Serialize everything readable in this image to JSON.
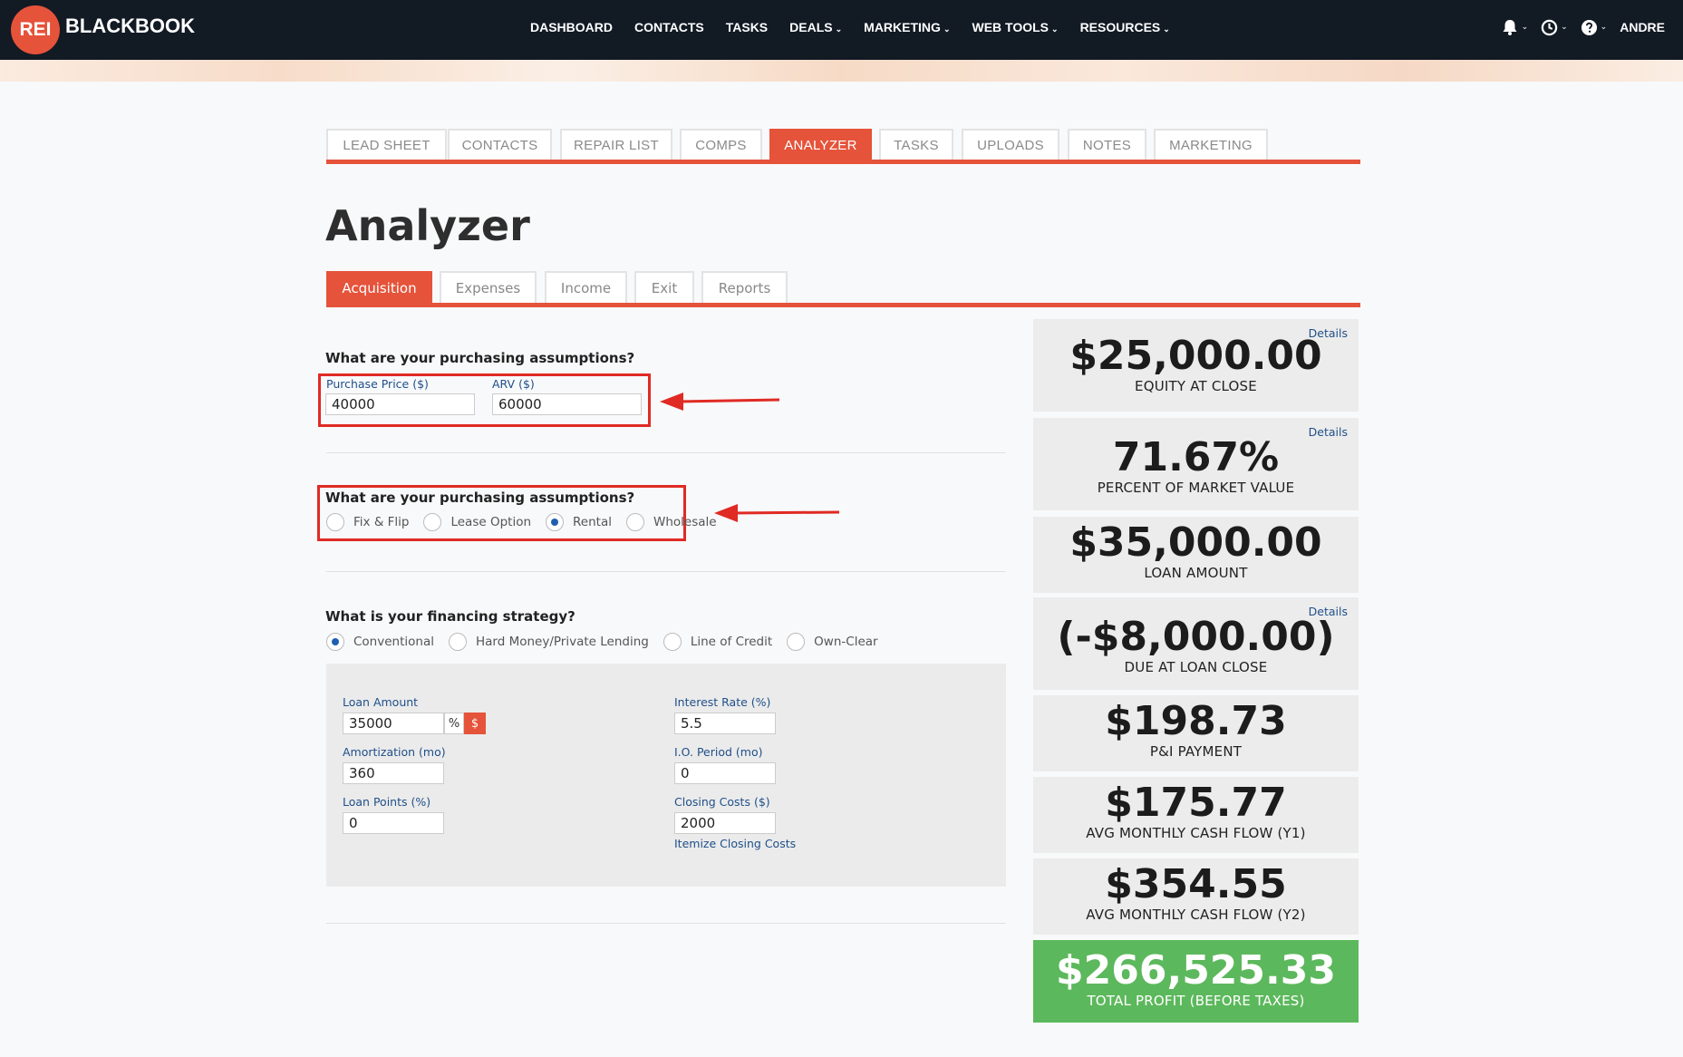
{
  "brand": {
    "logo_badge": "REI",
    "logo_text": "BLACKBOOK"
  },
  "nav": {
    "items": [
      "DASHBOARD",
      "CONTACTS",
      "TASKS",
      "DEALS",
      "MARKETING",
      "WEB TOOLS",
      "RESOURCES"
    ],
    "user": "ANDRE"
  },
  "record_tabs": [
    "LEAD SHEET",
    "CONTACTS",
    "REPAIR LIST",
    "COMPS",
    "ANALYZER",
    "TASKS",
    "UPLOADS",
    "NOTES",
    "MARKETING"
  ],
  "page_title": "Analyzer",
  "analyzer_tabs": [
    "Acquisition",
    "Expenses",
    "Income",
    "Exit",
    "Reports"
  ],
  "purchase": {
    "question": "What are your purchasing assumptions?",
    "price_label": "Purchase Price ($)",
    "price_value": "40000",
    "arv_label": "ARV ($)",
    "arv_value": "60000"
  },
  "strategy": {
    "question": "What are your purchasing assumptions?",
    "options": [
      "Fix & Flip",
      "Lease Option",
      "Rental",
      "Wholesale"
    ],
    "selected": "Rental"
  },
  "financing": {
    "question": "What is your financing strategy?",
    "options": [
      "Conventional",
      "Hard Money/Private Lending",
      "Line of Credit",
      "Own-Clear"
    ],
    "selected": "Conventional",
    "loan_amount_label": "Loan Amount",
    "loan_amount_value": "35000",
    "unit_percent": "%",
    "unit_dollar": "$",
    "amortization_label": "Amortization (mo)",
    "amortization_value": "360",
    "loan_points_label": "Loan Points (%)",
    "loan_points_value": "0",
    "interest_label": "Interest Rate (%)",
    "interest_value": "5.5",
    "io_label": "I.O. Period (mo)",
    "io_value": "0",
    "closing_label": "Closing Costs ($)",
    "closing_value": "2000",
    "itemize_link": "Itemize Closing Costs"
  },
  "summary": {
    "details_link": "Details",
    "equity_value": "$25,000.00",
    "equity_label": "EQUITY AT CLOSE",
    "pmv_value": "71.67%",
    "pmv_label": "PERCENT OF MARKET VALUE",
    "loan_value": "$35,000.00",
    "loan_label": "LOAN AMOUNT",
    "due_value": "(-$8,000.00)",
    "due_label": "DUE AT LOAN CLOSE",
    "pi_value": "$198.73",
    "pi_label": "P&I PAYMENT",
    "cf1_value": "$175.77",
    "cf1_label": "AVG MONTHLY CASH FLOW (Y1)",
    "cf2_value": "$354.55",
    "cf2_label": "AVG MONTHLY CASH FLOW (Y2)",
    "profit_value": "$266,525.33",
    "profit_label": "TOTAL PROFIT (BEFORE TAXES)"
  },
  "colors": {
    "accent": "#e5533a",
    "nav_bg": "#121a24",
    "highlight": "#e02a24",
    "profit_green": "#5cb85c",
    "link": "#1f4f8a"
  }
}
